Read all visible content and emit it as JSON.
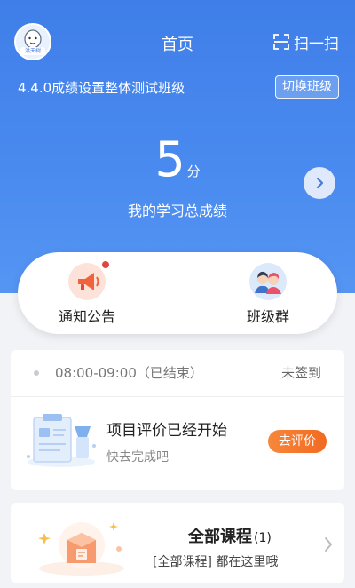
{
  "header": {
    "avatar_tag": "洪天树",
    "title": "首页",
    "scan_label": "扫一扫"
  },
  "class_info": {
    "name": "4.4.0成绩设置整体测试班级",
    "switch_label": "切换班级"
  },
  "score": {
    "value": "5",
    "unit": "分",
    "label": "我的学习总成绩"
  },
  "quick_actions": [
    {
      "label": "通知公告",
      "icon": "megaphone-icon",
      "has_badge": true
    },
    {
      "label": "班级群",
      "icon": "group-icon",
      "has_badge": false
    }
  ],
  "schedule": {
    "time": "08:00-09:00（已结束）",
    "status": "未签到"
  },
  "evaluation": {
    "title": "项目评价已经开始",
    "subtitle": "快去完成吧",
    "button_label": "去评价"
  },
  "courses": {
    "title": "全部课程",
    "count": "(1)",
    "subtitle": "[全部课程] 都在这里哦"
  },
  "colors": {
    "header_blue": "#3f7ee8",
    "accent_orange": "#f26a21",
    "badge_red": "#e5443c"
  }
}
